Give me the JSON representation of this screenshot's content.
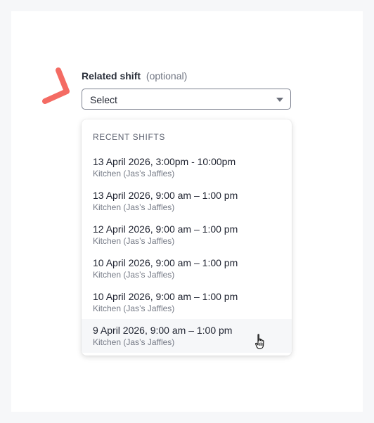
{
  "field": {
    "label": "Related shift",
    "hint": "(optional)",
    "select_value": "Select"
  },
  "menu": {
    "header": "RECENT SHIFTS",
    "options": [
      {
        "title": "13 April 2026, 3:00pm - 10:00pm",
        "subtitle": "Kitchen (Jas’s Jaffles)"
      },
      {
        "title": "13 April 2026, 9:00 am – 1:00 pm",
        "subtitle": "Kitchen (Jas’s Jaffles)"
      },
      {
        "title": "12 April 2026, 9:00 am – 1:00 pm",
        "subtitle": "Kitchen (Jas’s Jaffles)"
      },
      {
        "title": "10 April 2026, 9:00 am – 1:00 pm",
        "subtitle": "Kitchen (Jas’s Jaffles)"
      },
      {
        "title": "10 April 2026, 9:00 am – 1:00 pm",
        "subtitle": "Kitchen (Jas’s Jaffles)"
      },
      {
        "title": "9 April 2026, 9:00 am – 1:00 pm",
        "subtitle": "Kitchen (Jas’s Jaffles)"
      }
    ]
  },
  "icons": {
    "accent_mark": "arrow-accent-icon",
    "caret": "chevron-down-icon",
    "cursor": "pointer-hand-icon"
  },
  "colors": {
    "accent": "#f46b63",
    "text": "#202431",
    "muted": "#737884",
    "hover_bg": "#f6f7f9"
  }
}
